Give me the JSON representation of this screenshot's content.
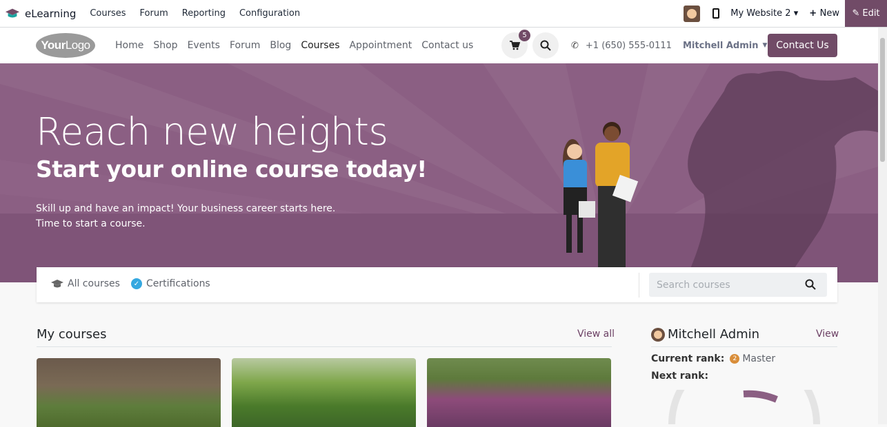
{
  "topbar": {
    "app_name": "eLearning",
    "menus": [
      "Courses",
      "Forum",
      "Reporting",
      "Configuration"
    ],
    "website": "My Website 2",
    "new_label": "New",
    "edit_label": "Edit"
  },
  "header": {
    "logo_text_1": "Your",
    "logo_text_2": "Logo",
    "nav": [
      "Home",
      "Shop",
      "Events",
      "Forum",
      "Blog",
      "Courses",
      "Appointment",
      "Contact us"
    ],
    "active_nav": "Courses",
    "cart_count": "5",
    "phone": "+1 (650) 555-0111",
    "user": "Mitchell Admin",
    "contact_button": "Contact Us"
  },
  "hero": {
    "title": "Reach new heights",
    "subtitle": "Start your online course today!",
    "line1": "Skill up and have an impact! Your business career starts here.",
    "line2": "Time to start a course."
  },
  "tabs": {
    "all_courses": "All courses",
    "certifications": "Certifications",
    "search_placeholder": "Search courses"
  },
  "my_courses": {
    "heading": "My courses",
    "view_all": "View all"
  },
  "profile": {
    "name": "Mitchell Admin",
    "view": "View",
    "current_rank_label": "Current rank:",
    "current_rank_value": "Master",
    "next_rank_label": "Next rank:"
  },
  "colors": {
    "brand": "#714b67",
    "hero": "#8b5f83"
  }
}
